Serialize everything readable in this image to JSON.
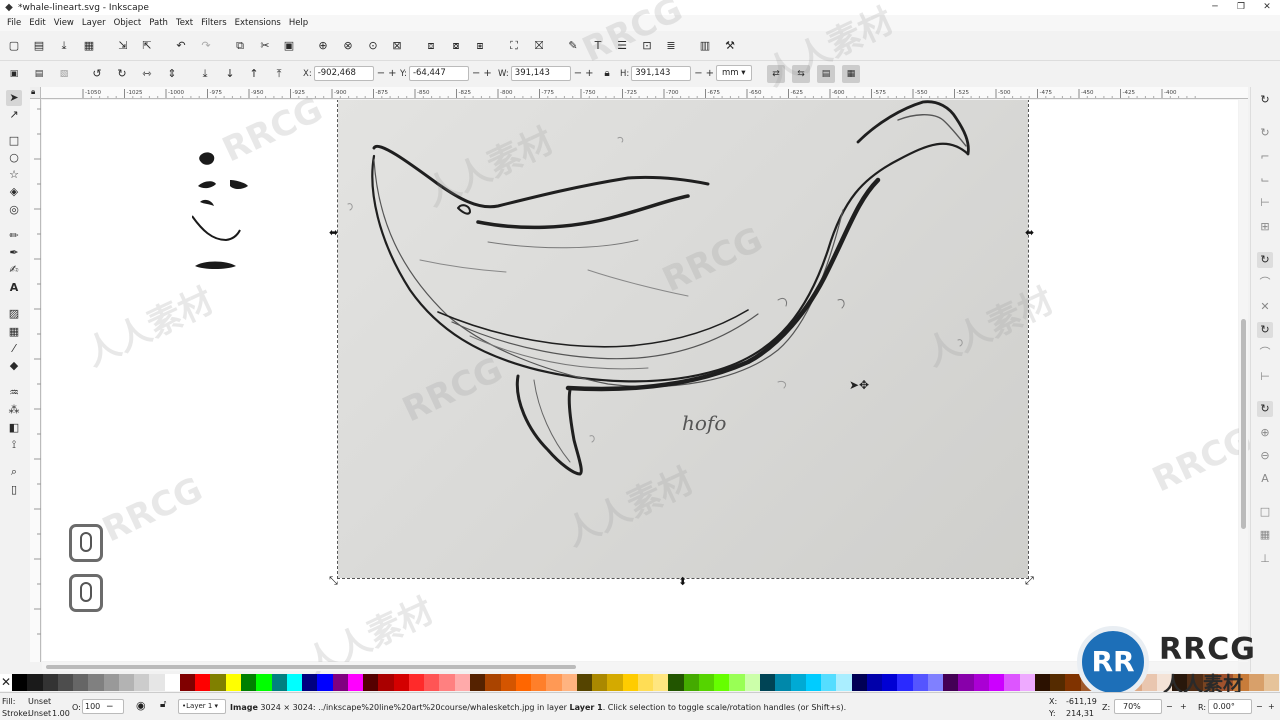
{
  "window": {
    "title": "*whale-lineart.svg - Inkscape",
    "controls": [
      "─",
      "❐",
      "✕"
    ]
  },
  "menu": [
    "File",
    "Edit",
    "View",
    "Layer",
    "Object",
    "Path",
    "Text",
    "Filters",
    "Extensions",
    "Help"
  ],
  "toolbar": {
    "x_label": "X:",
    "x_value": "-902,468",
    "y_label": "Y:",
    "y_value": "-64,447",
    "w_label": "W:",
    "w_value": "391,143",
    "h_label": "H:",
    "h_value": "391,143",
    "unit": "mm",
    "minus": "−",
    "plus": "+"
  },
  "ruler": {
    "ticks": [
      "-1050",
      "-1025",
      "-1000",
      "-975",
      "-950",
      "-925",
      "-900",
      "-875",
      "-850",
      "-825",
      "-800",
      "-775",
      "-750",
      "-725",
      "-700",
      "-675",
      "-650",
      "-625",
      "-600",
      "-575",
      "-550",
      "-525",
      "-500",
      "-475",
      "-450",
      "-425",
      "-400"
    ]
  },
  "canvas": {
    "signature": "hofo"
  },
  "watermarks": [
    "RRCG",
    "人人素材",
    "RRCG",
    "人人素材",
    "RRCG",
    "人人素材",
    "RRCG",
    "人人素材",
    "RRCG",
    "人人素材",
    "RRCG",
    "人人素材"
  ],
  "status": {
    "fill_label": "Fill:",
    "fill_value": "Unset",
    "stroke_label": "Stroke:",
    "stroke_value": "Unset",
    "stroke_width": "1.00",
    "opacity_label": "O:",
    "opacity_value": "100",
    "layer": "•Layer 1",
    "message_bold": "Image",
    "message": " 3024 × 3024: ../inkscape%20line%20art%20course/whalesketch.jpg in layer ",
    "message_layer": "Layer 1",
    "message_end": ". Click selection to toggle scale/rotation handles (or Shift+s).",
    "cursor_x_label": "X:",
    "cursor_x": "-611,19",
    "cursor_y_label": "Y:",
    "cursor_y": "214,31",
    "zoom_label": "Z:",
    "zoom": "70%",
    "rotate_label": "R:",
    "rotate": "0.00°"
  },
  "logo": {
    "brand": "RRCG",
    "sub": "人人素材"
  },
  "palette": [
    "#000000",
    "#1a1a1a",
    "#333333",
    "#4d4d4d",
    "#666666",
    "#808080",
    "#999999",
    "#b3b3b3",
    "#cccccc",
    "#e6e6e6",
    "#ffffff",
    "#800000",
    "#ff0000",
    "#808000",
    "#ffff00",
    "#008000",
    "#00ff00",
    "#008080",
    "#00ffff",
    "#000080",
    "#0000ff",
    "#800080",
    "#ff00ff",
    "#550000",
    "#aa0000",
    "#d40000",
    "#ff2a2a",
    "#ff5555",
    "#ff8080",
    "#ffaaaa",
    "#552200",
    "#aa4400",
    "#d45500",
    "#ff6600",
    "#ff7f2a",
    "#ff9955",
    "#ffb380",
    "#554400",
    "#aa8800",
    "#d4aa00",
    "#ffcc00",
    "#ffdd55",
    "#ffe680",
    "#225500",
    "#44aa00",
    "#55d400",
    "#66ff00",
    "#99ff55",
    "#ccffaa",
    "#004455",
    "#0088aa",
    "#00aad4",
    "#00ccff",
    "#55ddff",
    "#aaeeff",
    "#000055",
    "#0000aa",
    "#0000d4",
    "#2a2aff",
    "#5555ff",
    "#8080ff",
    "#440055",
    "#8800aa",
    "#aa00d4",
    "#cc00ff",
    "#dd55ff",
    "#eeaaff",
    "#2b1100",
    "#552b00",
    "#803300",
    "#a05a2c",
    "#c87137",
    "#d38d5f",
    "#deaa87",
    "#e9c6af",
    "#f4e3d7",
    "#28170b",
    "#502d16",
    "#784421",
    "#a0522d",
    "#c87c3a",
    "#d8a06a",
    "#e6c39a"
  ]
}
